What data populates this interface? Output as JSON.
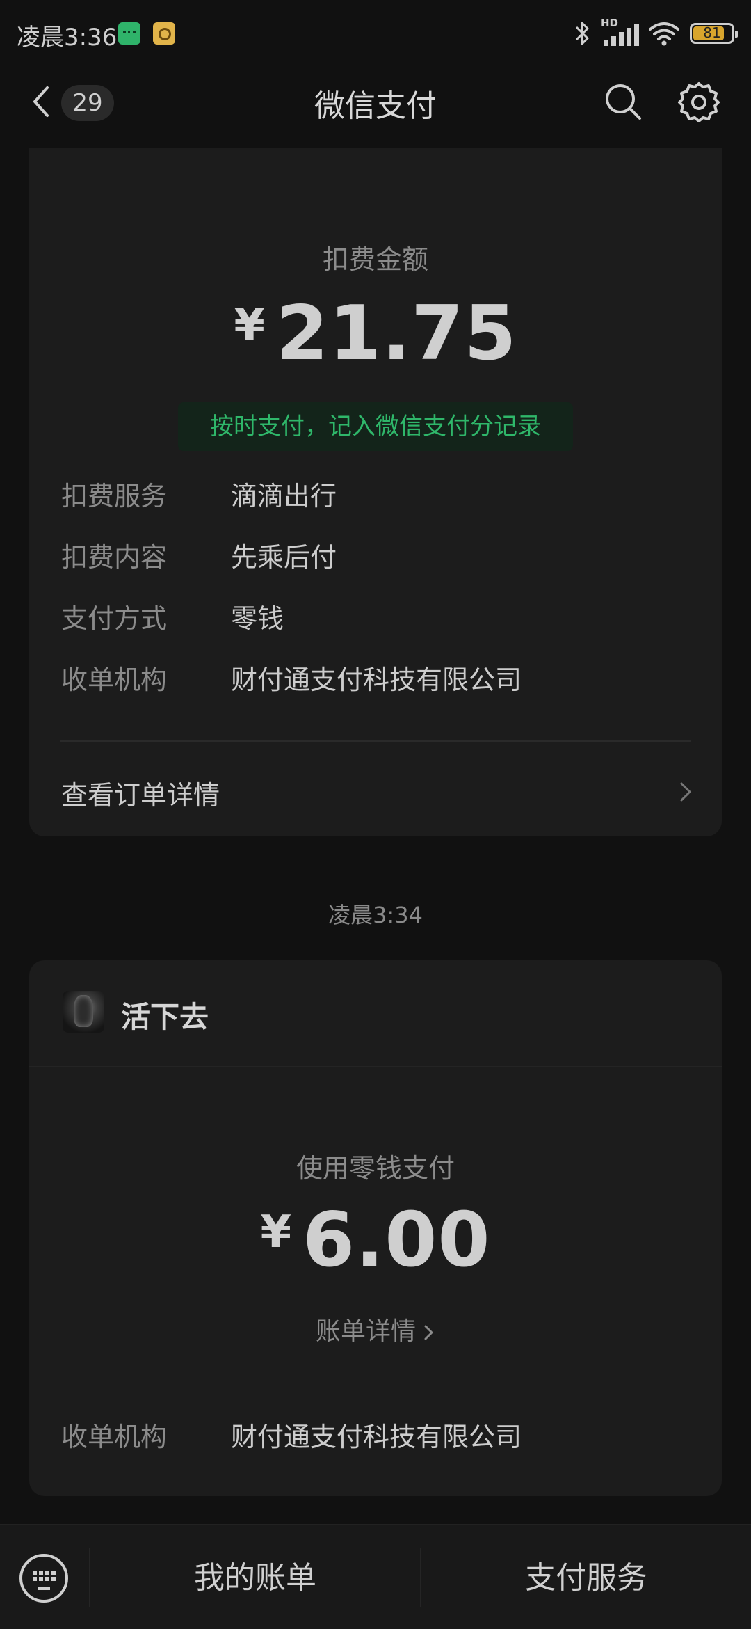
{
  "status_bar": {
    "time": "凌晨3:36",
    "network_label": "HD",
    "battery": "81",
    "battery_level": 0.81
  },
  "header": {
    "unread_count": "29",
    "title": "微信支付"
  },
  "card_deduction": {
    "label": "扣费金额",
    "currency": "¥",
    "amount": "21.75",
    "notice": "按时支付，记入微信支付分记录",
    "details": [
      {
        "key": "扣费服务",
        "value": "滴滴出行"
      },
      {
        "key": "扣费内容",
        "value": "先乘后付"
      },
      {
        "key": "支付方式",
        "value": "零钱"
      },
      {
        "key": "收单机构",
        "value": "财付通支付科技有限公司"
      }
    ],
    "order_link": "查看订单详情"
  },
  "timestamp": "凌晨3:34",
  "card_payment": {
    "merchant": "活下去",
    "label": "使用零钱支付",
    "currency": "¥",
    "amount": "6.00",
    "bill_link": "账单详情",
    "detail": {
      "key": "收单机构",
      "value": "财付通支付科技有限公司"
    }
  },
  "bottom_bar": {
    "menu_1": "我的账单",
    "menu_2": "支付服务"
  },
  "colors": {
    "background": "#111111",
    "card": "#1c1c1c",
    "accent_green": "#2fb76a",
    "battery": "#d8a52d"
  },
  "icons": [
    "back-arrow-icon",
    "search-icon",
    "gear-icon",
    "keyboard-icon",
    "chevron-right-icon",
    "bluetooth-icon",
    "signal-icon",
    "wifi-icon",
    "battery-icon"
  ]
}
